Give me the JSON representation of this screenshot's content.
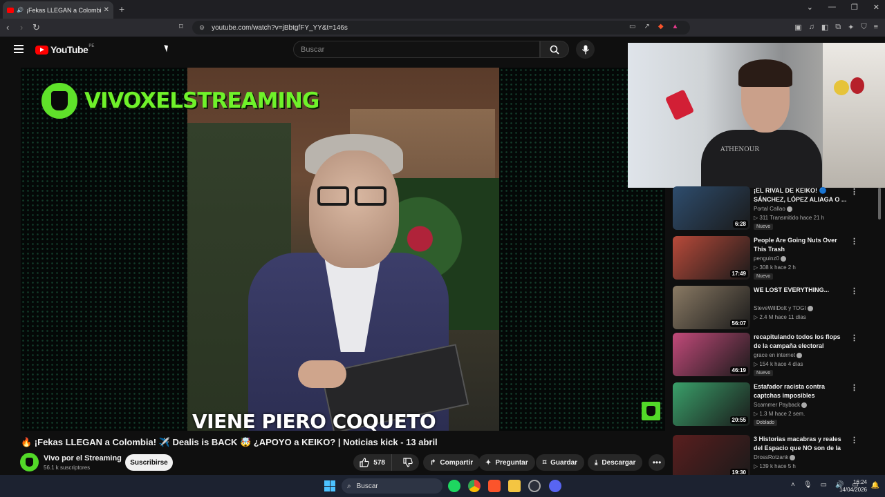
{
  "browser": {
    "tab_title": "¡Fekas LLEGAN a Colombia",
    "new_tab": "+",
    "url": "youtube.com/watch?v=jBbtgfFY_YY&t=146s"
  },
  "youtube": {
    "logo_text": "YouTube",
    "country": "PE",
    "search_placeholder": "Buscar"
  },
  "video": {
    "overlay_title": "VIVOXELSTREAMING",
    "caption": "VIENE PIERO COQUETO",
    "title": "🔥 ¡Fekas LLEGAN a Colombia! ✈️ Dealis is BACK 🤯 ¿APOYO a KEIKO? | Noticias kick - 13 abril",
    "channel_name": "Vivo por el Streaming",
    "subscribers": "56.1 k suscriptores",
    "subscribe_label": "Suscribirse",
    "likes": "578",
    "share_label": "Compartir",
    "ask_label": "Preguntar",
    "save_label": "Guardar",
    "download_label": "Descargar"
  },
  "webcam": {
    "shirt_text": "ATHENOUR"
  },
  "recommendations": [
    {
      "title": "¡EL RIVAL DE KEIKO! 🔵 SÁNCHEZ, LÓPEZ ALIAGA O ...",
      "channel": "Portal Callao",
      "meta": "▷ 311  Transmitido hace 21 h",
      "duration": "6:28",
      "badge": "Nuevo",
      "thumb": "#2e4d6e"
    },
    {
      "title": "People Are Going Nuts Over This Trash",
      "channel": "penguinz0",
      "meta": "▷ 308 k  hace 2 h",
      "duration": "17:49",
      "badge": "Nuevo",
      "thumb": "#b84a3a"
    },
    {
      "title": "WE LOST EVERYTHING...",
      "channel": "SteveWillDoIt  y TOGI",
      "meta": "▷ 2.4 M  hace 11 días",
      "duration": "56:07",
      "badge": "",
      "thumb": "#8a7a64"
    },
    {
      "title": "recapitulando todos los flops de la campaña electoral",
      "channel": "grace en internet",
      "meta": "▷ 154 k  hace 4 días",
      "duration": "46:19",
      "badge": "Nuevo",
      "thumb": "#c24a7a"
    },
    {
      "title": "Estafador racista contra captchas imposibles",
      "channel": "Scammer Payback",
      "meta": "▷ 1.3 M  hace 2 sem.",
      "duration": "20:55",
      "badge": "Doblado",
      "thumb": "#3aa06a"
    },
    {
      "title": "3 Historias macabras y reales del Espacio que NO son de la ...",
      "channel": "DrossRotzank",
      "meta": "▷ 139 k  hace 5 h",
      "duration": "19:30",
      "badge": "",
      "thumb": "#5a1e1e"
    }
  ],
  "taskbar": {
    "search": "Buscar",
    "time": "16:24",
    "date": "14/04/2026"
  }
}
